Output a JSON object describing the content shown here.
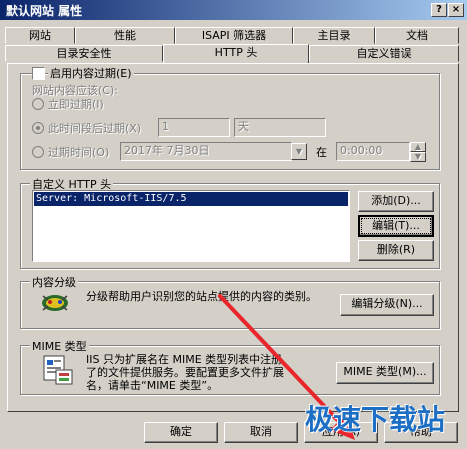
{
  "window": {
    "title": "默认网站 属性",
    "help_glyph": "?",
    "close_glyph": "×"
  },
  "tabs_back": [
    "网站",
    "性能",
    "ISAPI 筛选器",
    "主目录",
    "文档"
  ],
  "tabs_front": [
    "目录安全性",
    "HTTP 头",
    "自定义错误"
  ],
  "expire": {
    "enable_label": "启用内容过期(E)",
    "group_label": "网站内容应该(C):",
    "immediate_label": "立即过期(I)",
    "after_label": "此时间段后过期(X)",
    "after_value": "1",
    "after_unit": "天",
    "on_label": "过期时间(O)",
    "on_date": "2017年 7月30日",
    "at_label": "在",
    "on_time": "0:00:00"
  },
  "custom_http": {
    "group_label": "自定义 HTTP 头",
    "selected_header": "Server: Microsoft-IIS/7.5",
    "add_label": "添加(D)...",
    "edit_label": "编辑(T)...",
    "remove_label": "删除(R)"
  },
  "rating": {
    "group_label": "内容分级",
    "description": "分级帮助用户识别您的站点提供的内容的类别。",
    "edit_label": "编辑分级(N)..."
  },
  "mime": {
    "group_label": "MIME 类型",
    "description_line1": "IIS 只为扩展名在 MIME 类型列表中注册",
    "description_line2": "了的文件提供服务。要配置更多文件扩展",
    "description_line3": "名，请单击“MIME 类型”。",
    "button_label": "MIME 类型(M)..."
  },
  "footer": {
    "ok_label": "确定",
    "cancel_label": "取消",
    "apply_label": "应用(A)",
    "help_label": "帮助"
  },
  "watermark": {
    "text": "极速下载站"
  },
  "colors": {
    "title_active": "#0a246a",
    "selection": "#0a246a",
    "arrow": "#e8262c",
    "watermark": "#1c6fc4",
    "face": "#d4d0c8"
  }
}
